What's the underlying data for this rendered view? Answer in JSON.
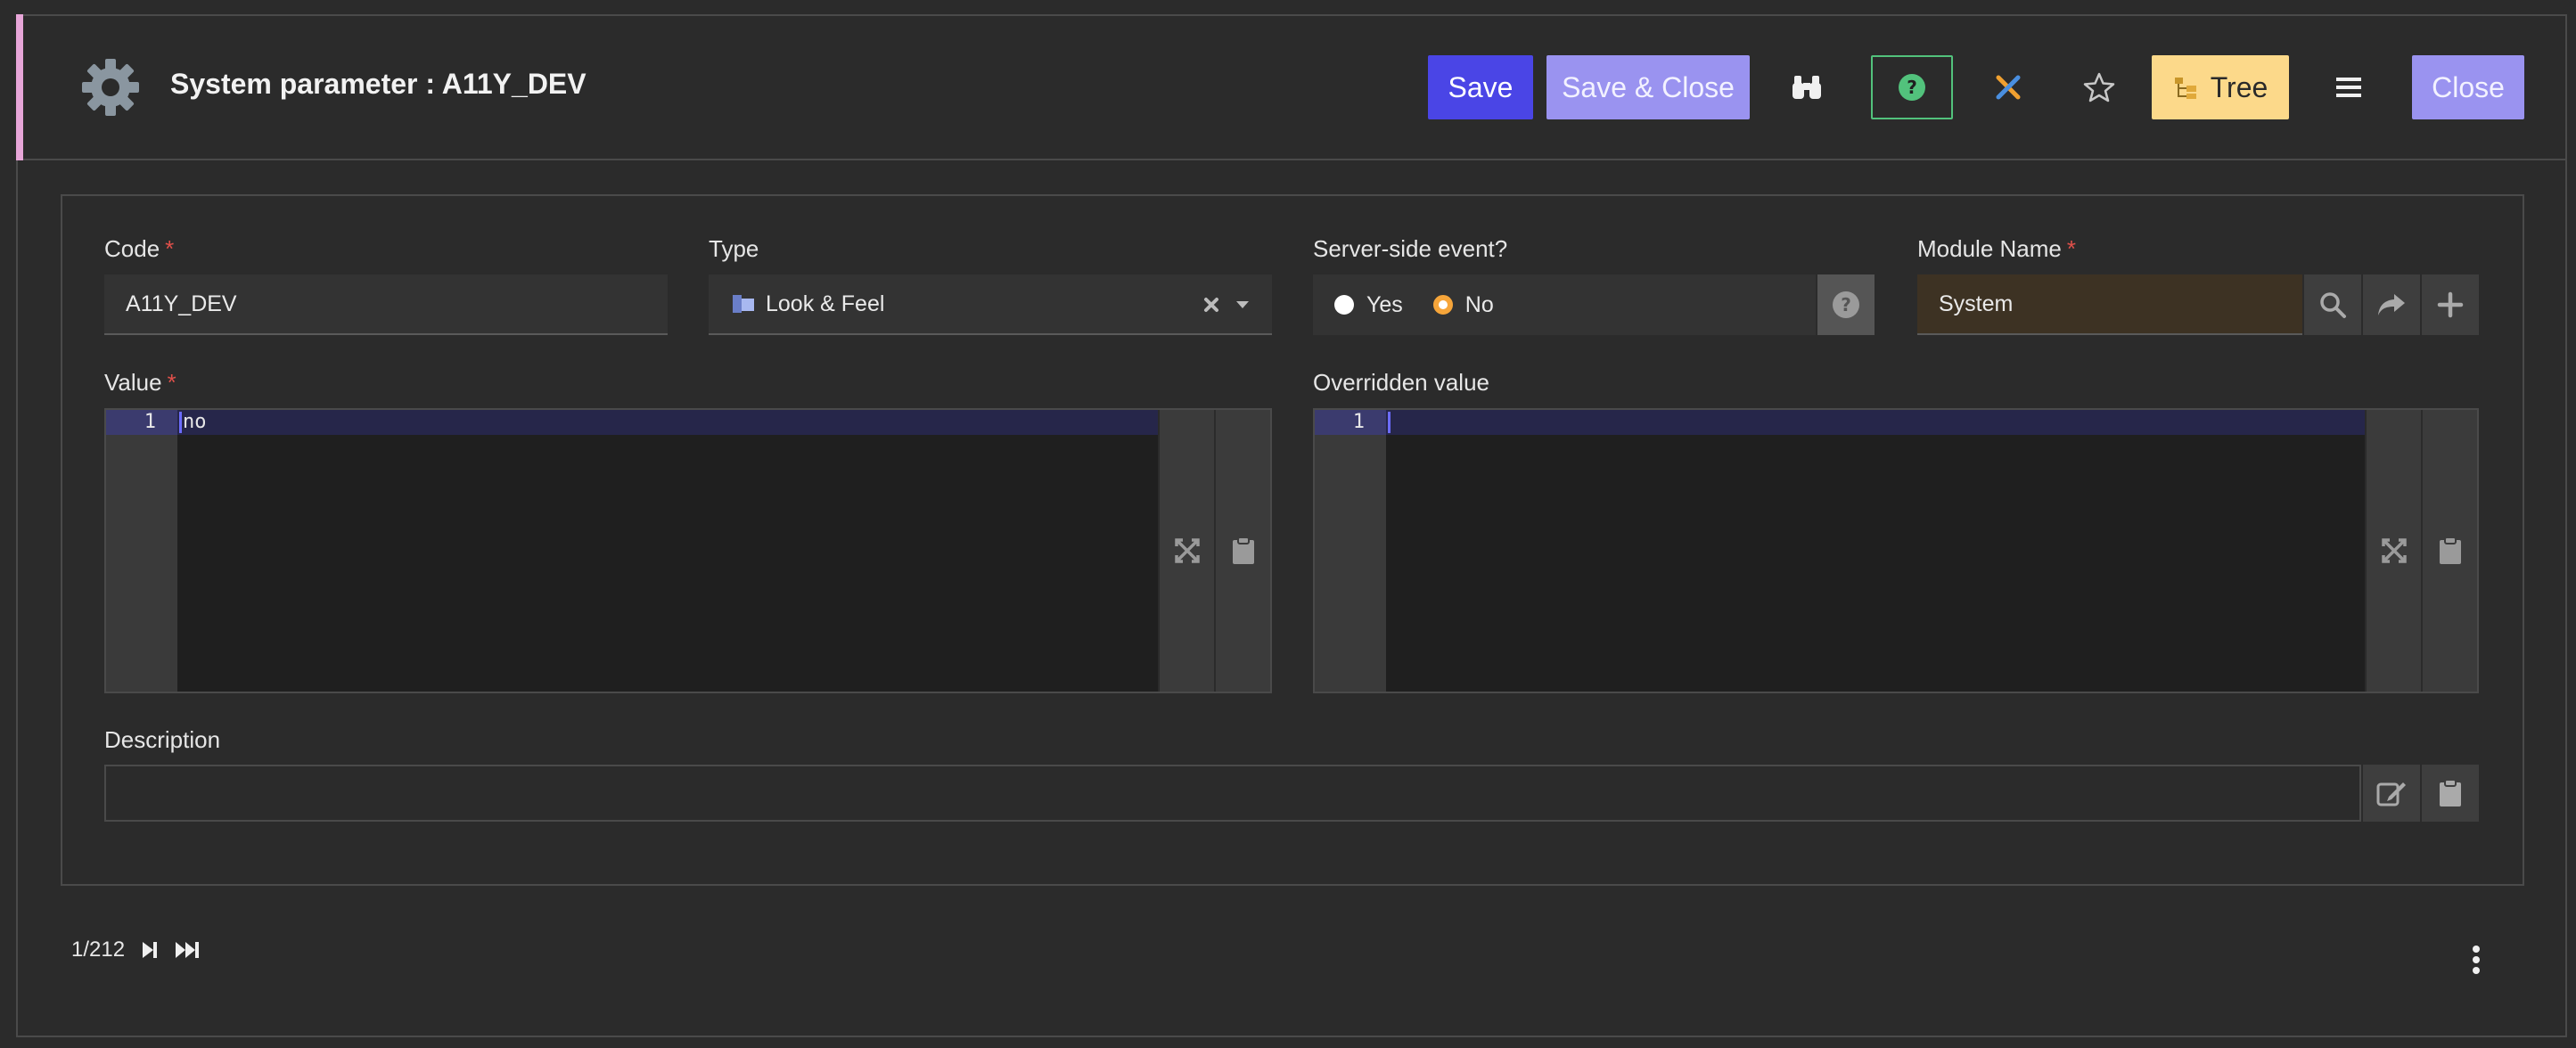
{
  "header": {
    "title": "System parameter : A11Y_DEV",
    "buttons": {
      "save": "Save",
      "save_close": "Save & Close",
      "tree": "Tree",
      "close": "Close"
    }
  },
  "form": {
    "code": {
      "label": "Code",
      "required_mark": "*",
      "value": "A11Y_DEV"
    },
    "type": {
      "label": "Type",
      "value": "Look & Feel"
    },
    "server_side": {
      "label": "Server-side event?",
      "options": [
        "Yes",
        "No"
      ],
      "selected": "No"
    },
    "module": {
      "label": "Module Name",
      "required_mark": "*",
      "value": "System"
    },
    "value": {
      "label": "Value",
      "required_mark": "*",
      "line_number": "1",
      "content": "no"
    },
    "overridden": {
      "label": "Overridden value",
      "line_number": "1",
      "content": ""
    },
    "description": {
      "label": "Description",
      "value": ""
    }
  },
  "footer": {
    "pager": "1/212"
  },
  "colors": {
    "accent": "#e7a6d8",
    "save": "#4a45e6",
    "secondary": "#9a93f0",
    "tree": "#fcd98a",
    "help_border": "#52c27c",
    "required": "#e0504a",
    "radio_selected": "#f6a53a",
    "module_field": "#3d3223"
  },
  "icons": [
    "gear-icon",
    "binoculars-icon",
    "help-icon",
    "tools-icon",
    "star-icon",
    "tree-icon",
    "hamburger-icon",
    "flag-icon",
    "clear-icon",
    "caret-down-icon",
    "question-icon",
    "search-icon",
    "share-icon",
    "plus-icon",
    "expand-icon",
    "clipboard-icon",
    "edit-icon",
    "next-icon",
    "last-icon",
    "kebab-icon"
  ]
}
